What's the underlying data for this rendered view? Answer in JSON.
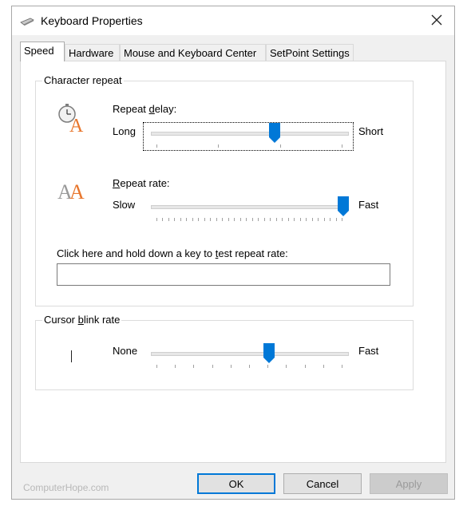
{
  "window": {
    "title": "Keyboard Properties",
    "icon": "keyboard-icon",
    "close_icon": "close-icon"
  },
  "tabs": [
    {
      "label": "Speed",
      "active": true
    },
    {
      "label": "Hardware",
      "active": false
    },
    {
      "label": "Mouse and Keyboard Center",
      "active": false
    },
    {
      "label": "SetPoint Settings",
      "active": false
    }
  ],
  "character_repeat": {
    "group_label": "Character repeat",
    "repeat_delay": {
      "label_pre": "Repeat ",
      "label_ul": "d",
      "label_post": "elay:",
      "min_label": "Long",
      "max_label": "Short",
      "value_fraction": 0.63,
      "tick_count": 4
    },
    "repeat_rate": {
      "label_pre": "",
      "label_ul": "R",
      "label_post": "epeat rate:",
      "min_label": "Slow",
      "max_label": "Fast",
      "value_fraction": 0.98,
      "tick_count": 32
    },
    "test": {
      "label_pre": "Click here and hold down a key to ",
      "label_ul": "t",
      "label_post": "est repeat rate:",
      "value": "",
      "placeholder": ""
    }
  },
  "cursor_blink": {
    "group_label_pre": "Cursor ",
    "group_label_ul": "b",
    "group_label_post": "link rate",
    "min_label": "None",
    "max_label": "Fast",
    "value_fraction": 0.6,
    "tick_count": 11
  },
  "buttons": {
    "ok": "OK",
    "cancel": "Cancel",
    "apply": "Apply"
  },
  "watermark": "ComputerHope.com",
  "colors": {
    "accent": "#0078d7",
    "icon_orange": "#e8772e",
    "icon_gray": "#9a9a9a"
  }
}
